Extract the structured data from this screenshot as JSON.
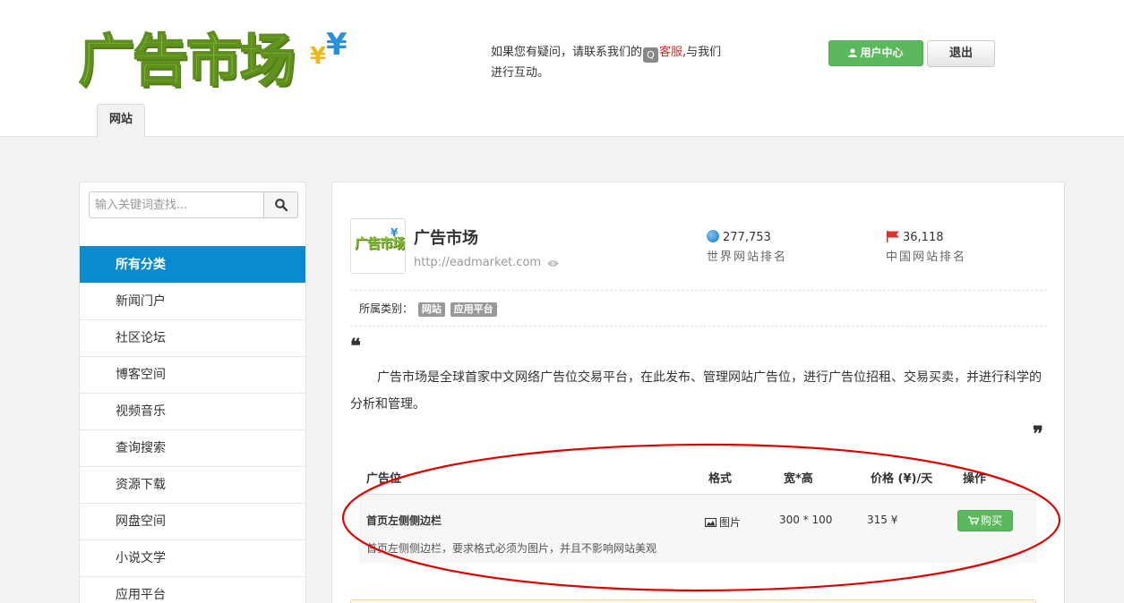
{
  "header": {
    "logo_text": "广告市场",
    "logo_symbol": "¥",
    "contact_prefix": "如果您有疑问，请联系我们的",
    "contact_link": "客服",
    "contact_suffix": ",与我们进行互动。",
    "qq_icon": "qq-penguin-icon",
    "user_center_label": "用户中心",
    "logout_label": "退出",
    "tab_label": "网站"
  },
  "sidebar": {
    "search_placeholder": "输入关键词查找...",
    "categories": [
      "所有分类",
      "新闻门户",
      "社区论坛",
      "博客空间",
      "视频音乐",
      "查询搜索",
      "资源下载",
      "网盘空间",
      "小说文学",
      "应用平台"
    ],
    "active_index": 0
  },
  "site": {
    "name": "广告市场",
    "url": "http://eadmarket.com",
    "thumb_text": "广告市场",
    "world_rank": "277,753",
    "world_rank_label": "世界网站排名",
    "china_rank": "36,118",
    "china_rank_label": "中国网站排名",
    "category_label": "所属类别：",
    "category_badges": [
      "网站",
      "应用平台"
    ],
    "description": "广告市场是全球首家中文网络广告位交易平台，在此发布、管理网站广告位，进行广告位招租、交易买卖，并进行科学的分析和管理。"
  },
  "ad_table": {
    "headers": {
      "position": "广告位",
      "format": "格式",
      "size": "宽*高",
      "price": "价格 (¥)/天",
      "action": "操作"
    },
    "rows": [
      {
        "title": "首页左侧侧边栏",
        "desc": "首页左侧侧边栏，要求格式必须为图片，并且不影响网站美观",
        "format": "图片",
        "size": "300 * 100",
        "price": "315 ¥",
        "buy_label": "购买"
      }
    ]
  },
  "colors": {
    "primary_blue": "#0a8bcf",
    "green_button": "#5cb85c",
    "annotation_red": "#e00000"
  }
}
